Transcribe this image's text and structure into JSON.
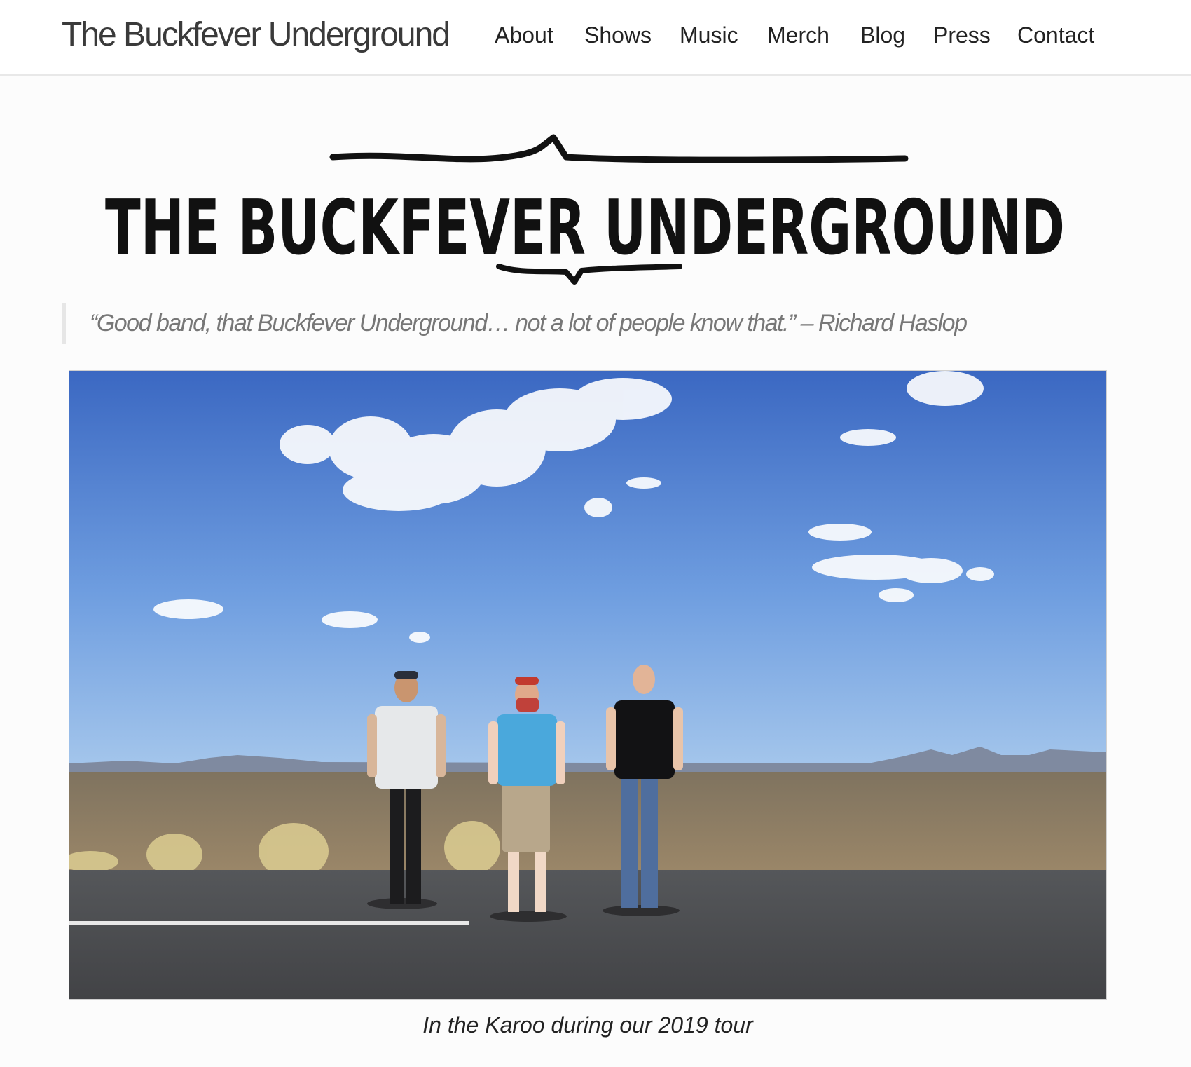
{
  "header": {
    "site_title": "The Buckfever Underground",
    "nav": [
      {
        "label": "About"
      },
      {
        "label": "Shows"
      },
      {
        "label": "Music"
      },
      {
        "label": "Merch"
      },
      {
        "label": "Blog"
      },
      {
        "label": "Press"
      },
      {
        "label": "Contact"
      }
    ]
  },
  "logo": {
    "text": "THE BUCKFEVER UNDERGROUND"
  },
  "quote": {
    "text": "“Good band, that Buckfever Underground… not a lot of people know that.” – Richard Haslop"
  },
  "photo": {
    "caption": "In the Karoo during our 2019 tour"
  },
  "colors": {
    "sky_top": "#3c6bc4",
    "sky_bottom": "#9fc3ea",
    "ground": "#8c7d62",
    "road": "#4a4a4c",
    "shirt_blue": "#4aa8dc",
    "nav_text": "#222222",
    "quote_text": "#777777"
  }
}
